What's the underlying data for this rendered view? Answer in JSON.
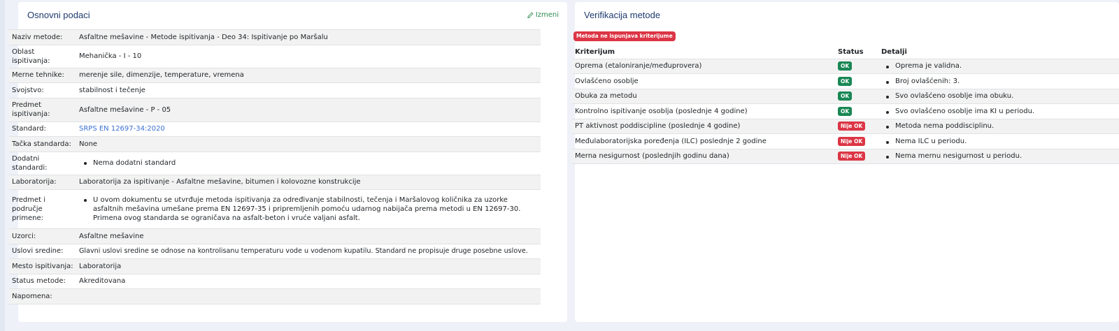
{
  "basic": {
    "title": "Osnovni podaci",
    "edit_label": "Izmeni",
    "rows": [
      {
        "label": "Naziv metode:",
        "value": "Asfaltne mešavine - Metode ispitivanja - Deo 34: Ispitivanje po Maršalu"
      },
      {
        "label": "Oblast ispitivanja:",
        "value": "Mehanička - I - 10"
      },
      {
        "label": "Merne tehnike:",
        "value": "merenje sile, dimenzije, temperature, vremena"
      },
      {
        "label": "Svojstvo:",
        "value": "stabilnost i tečenje"
      },
      {
        "label": "Predmet ispitivanja:",
        "value": "Asfaltne mešavine - P - 05"
      },
      {
        "label": "Standard:",
        "value": "SRPS EN 12697-34:2020"
      },
      {
        "label": "Tačka standarda:",
        "value": "None"
      },
      {
        "label": "Dodatni standardi:",
        "value": "Nema dodatni standard"
      },
      {
        "label": "Laboratorija:",
        "value": "Laboratorija za ispitivanje - Asfaltne mešavine, bitumen i kolovozne konstrukcije"
      },
      {
        "label": "Predmet i područje primene:",
        "value": "U ovom dokumentu se utvrđuje metoda ispitivanja za određivanje stabilnosti, tečenja i Maršalovog količnika za uzorke asfaltnih mešavina umešane prema EN 12697-35 i pripremljenih pomoću udarnog nabijača prema metodi u EN 12697-30. Primena ovog standarda se ograničava na asfalt-beton i vruće valjani asfalt."
      },
      {
        "label": "Uzorci:",
        "value": "Asfaltne mešavine"
      },
      {
        "label": "Uslovi sredine:",
        "value": "Glavni uslovi sredine se odnose na kontrolisanu temperaturu vode u vodenom kupatilu. Standard ne propisuje druge posebne uslove."
      },
      {
        "label": "Mesto ispitivanja:",
        "value": "Laboratorija"
      },
      {
        "label": "Status metode:",
        "value": "Akreditovana"
      },
      {
        "label": "Napomena:",
        "value": ""
      }
    ]
  },
  "verification": {
    "title": "Verifikacija metode",
    "warning_badge": "Metoda ne ispunjava kriterijume",
    "headers": {
      "criterion": "Kriterijum",
      "status": "Status",
      "details": "Detalji"
    },
    "rows": [
      {
        "criterion": "Oprema (etaloniranje/međuprovera)",
        "status": "OK",
        "detail": "Oprema je validna."
      },
      {
        "criterion": "Ovlašćeno osoblje",
        "status": "OK",
        "detail": "Broj ovlašćenih: 3."
      },
      {
        "criterion": "Obuka za metodu",
        "status": "OK",
        "detail": "Svo ovlašćeno osoblje ima obuku."
      },
      {
        "criterion": "Kontrolno ispitivanje osoblja (poslednje 4 godine)",
        "status": "OK",
        "detail": "Svo ovlašćeno osoblje ima KI u periodu."
      },
      {
        "criterion": "PT aktivnost poddiscipline (poslednje 4 godine)",
        "status": "Nije OK",
        "detail": "Metoda nema poddisciplinu."
      },
      {
        "criterion": "Međulaboratorijska poređenja (ILC) poslednje 2 godine",
        "status": "Nije OK",
        "detail": "Nema ILC u periodu."
      },
      {
        "criterion": "Merna nesigurnost (poslednjih godinu dana)",
        "status": "Nije OK",
        "detail": "Nema mernu nesigurnost u periodu."
      }
    ]
  },
  "colors": {
    "title": "#1e3a6e",
    "ok": "#198754",
    "not_ok": "#dc3545",
    "link": "#3b6fd6",
    "edit": "#2c8a50"
  }
}
